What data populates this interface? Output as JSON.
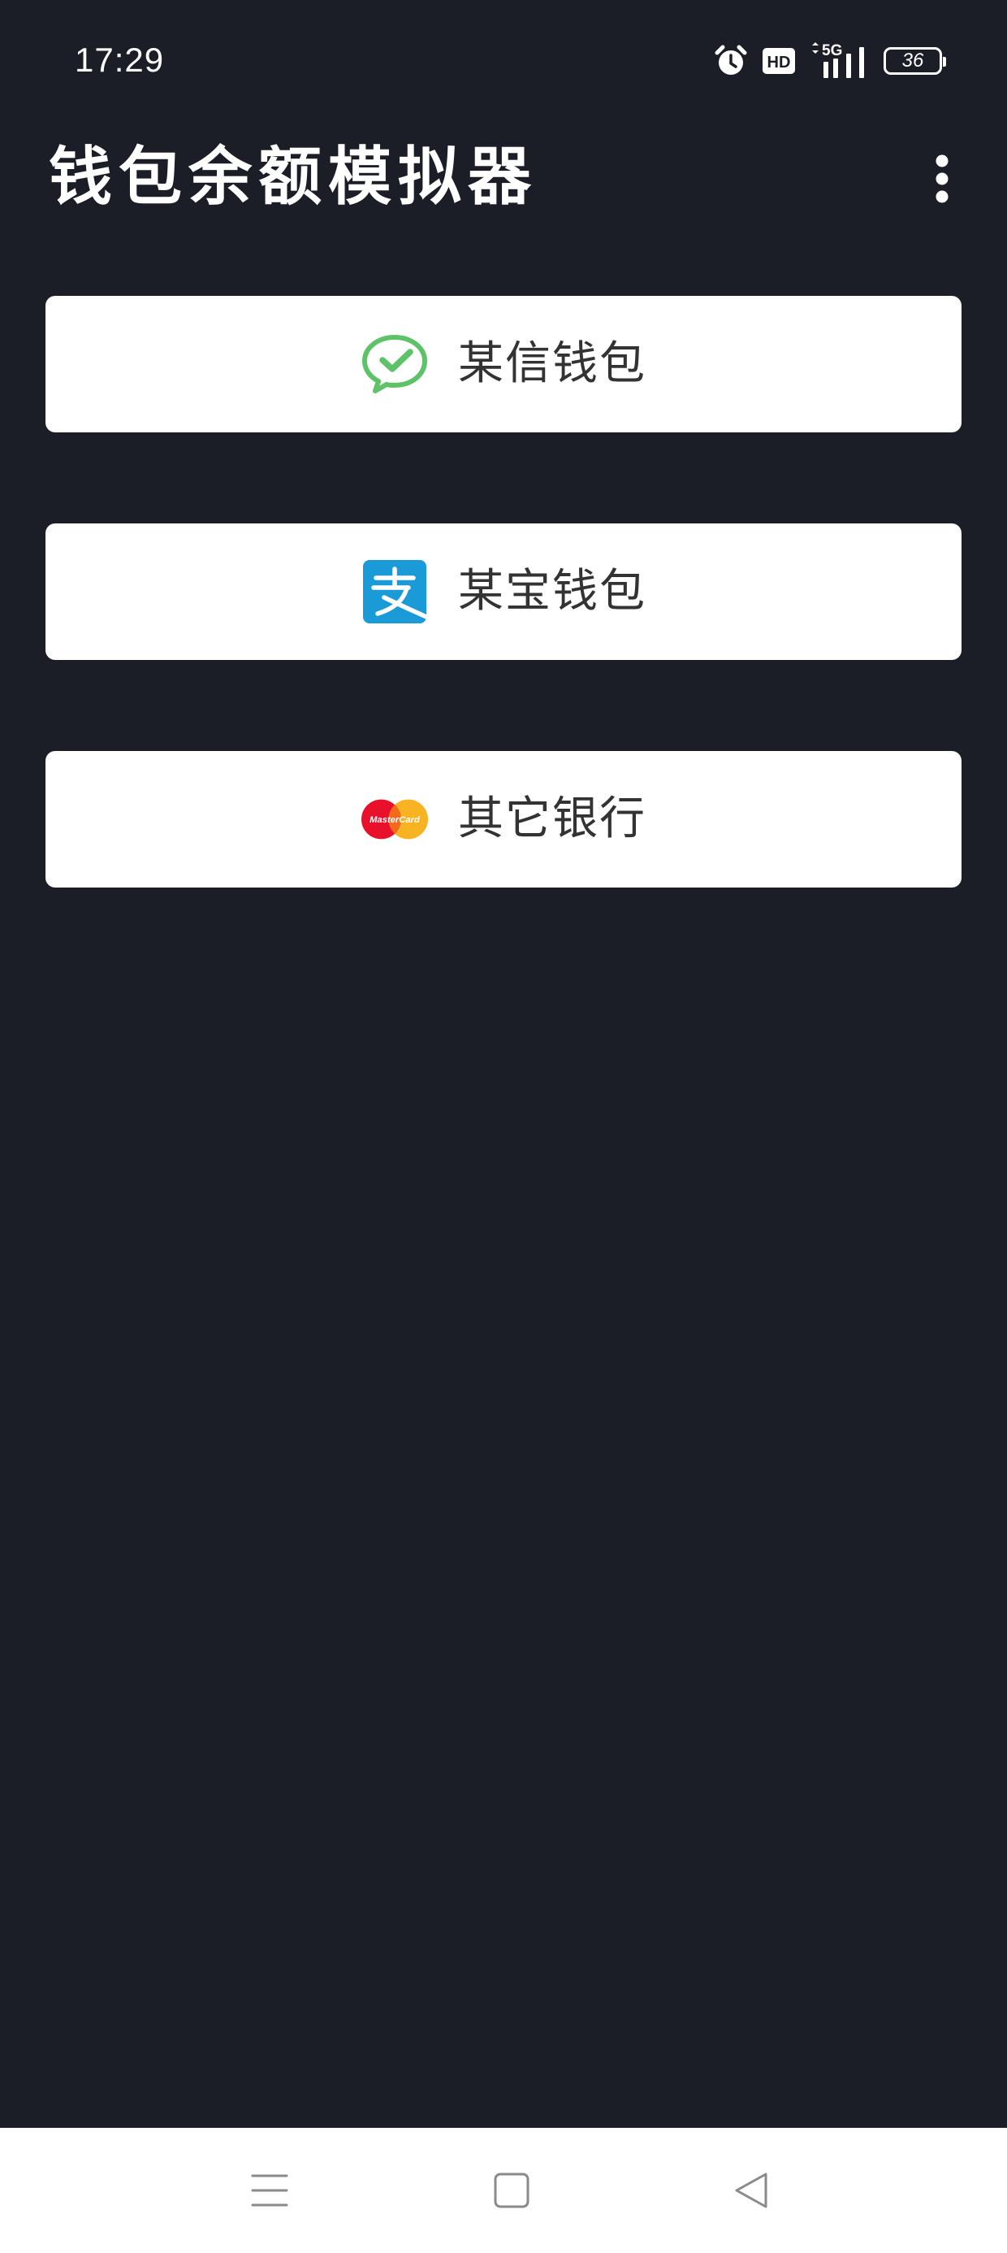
{
  "status_bar": {
    "time": "17:29",
    "hd_label": "HD",
    "network_label": "5G",
    "battery": "36",
    "icons": [
      "alarm-icon",
      "hd-icon",
      "signal-5g-icon",
      "battery-icon"
    ]
  },
  "app_bar": {
    "title": "钱包余额模拟器",
    "menu_icon": "more-vert-icon"
  },
  "wallets": [
    {
      "label": "某信钱包",
      "icon": "wechat-icon",
      "color": "#5ec269"
    },
    {
      "label": "某宝钱包",
      "icon": "alipay-icon",
      "color": "#1a9bd8"
    },
    {
      "label": "其它银行",
      "icon": "mastercard-icon",
      "color": "#e8102a",
      "secondary_color": "#f8b323",
      "icon_text": "MasterCard"
    }
  ],
  "nav_bar": {
    "icons": [
      "menu-icon",
      "home-icon",
      "back-icon"
    ]
  },
  "colors": {
    "background": "#1b1e27",
    "button_background": "#ffffff",
    "button_text": "#333333",
    "nav_background": "#ffffff",
    "nav_icon": "#8a8a8a"
  }
}
